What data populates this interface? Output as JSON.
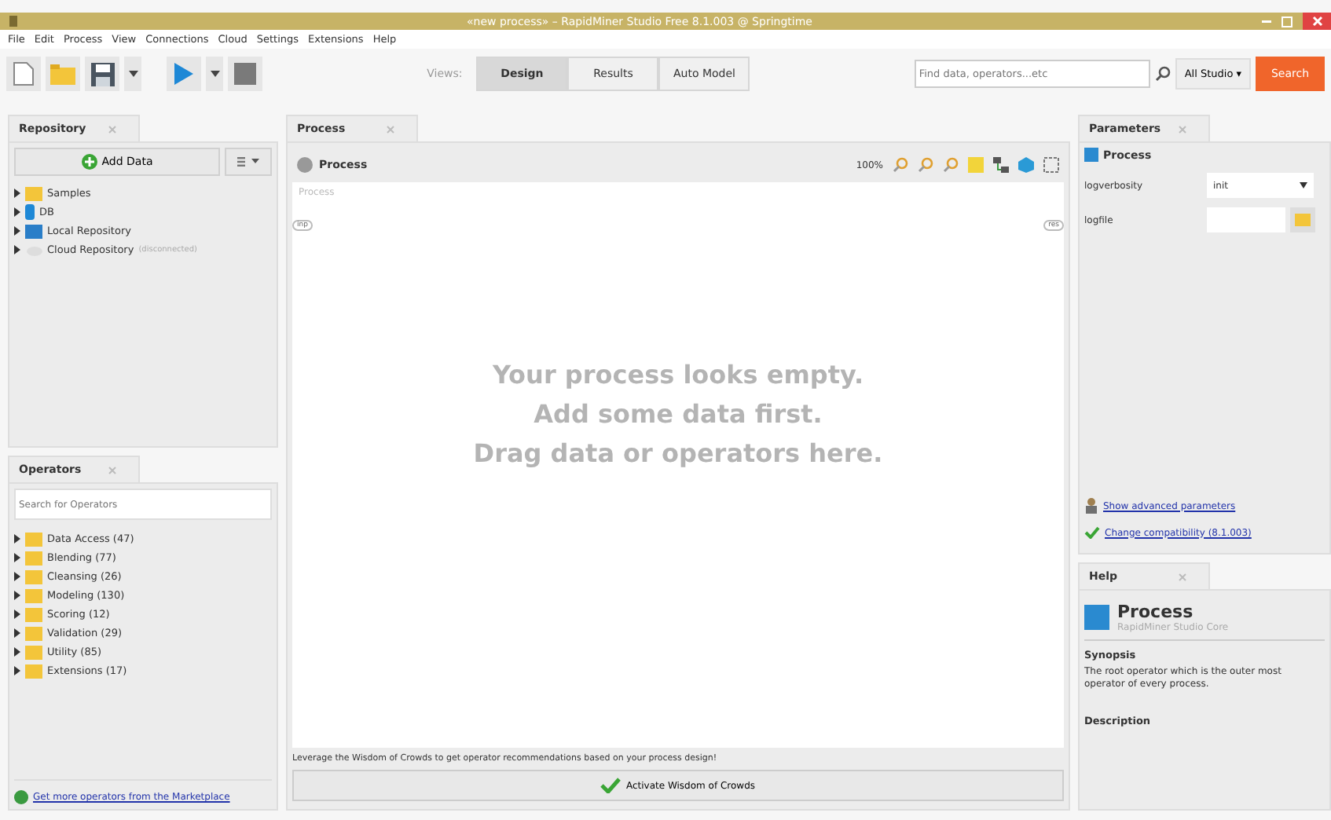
{
  "window": {
    "title": "«new process» – RapidMiner Studio Free 8.1.003 @ Springtime"
  },
  "menu": [
    "File",
    "Edit",
    "Process",
    "View",
    "Connections",
    "Cloud",
    "Settings",
    "Extensions",
    "Help"
  ],
  "toolbar": {
    "views_label": "Views:",
    "views": [
      {
        "label": "Design",
        "selected": true
      },
      {
        "label": "Results",
        "selected": false
      },
      {
        "label": "Auto Model",
        "selected": false
      }
    ],
    "search": {
      "placeholder": "Find data, operators...etc"
    },
    "scope": "All Studio ▾",
    "search_button": "Search"
  },
  "repository": {
    "tab": "Repository",
    "add_data": "Add Data",
    "items": [
      {
        "label": "Samples",
        "kind": "folder"
      },
      {
        "label": "DB",
        "kind": "db"
      },
      {
        "label": "Local Repository",
        "kind": "local"
      },
      {
        "label": "Cloud Repository",
        "note": "(disconnected)",
        "kind": "cloud"
      }
    ]
  },
  "operators": {
    "tab": "Operators",
    "search": {
      "placeholder": "Search for Operators"
    },
    "items": [
      "Data Access (47)",
      "Blending (77)",
      "Cleansing (26)",
      "Modeling (130)",
      "Scoring (12)",
      "Validation (29)",
      "Utility (85)",
      "Extensions (17)"
    ],
    "marketplace_link": "Get more operators from the Marketplace"
  },
  "process": {
    "tab": "Process",
    "breadcrumb": "Process",
    "zoom": "100%",
    "canvas_label": "Process",
    "port_in": "inp",
    "port_out": "res",
    "empty_lines": [
      "Your process looks empty.",
      "Add some data first.",
      "Drag data or operators here."
    ],
    "wisdom_text": "Leverage the Wisdom of Crowds to get operator recommendations based on your process design!",
    "wisdom_button": "Activate Wisdom of Crowds"
  },
  "parameters": {
    "tab": "Parameters",
    "operator": "Process",
    "rows": [
      {
        "label": "logverbosity",
        "kind": "select",
        "value": "init"
      },
      {
        "label": "logfile",
        "kind": "file",
        "value": ""
      }
    ],
    "advanced_link": "Show advanced parameters",
    "compat_link": "Change compatibility (8.1.003)"
  },
  "help": {
    "tab": "Help",
    "title": "Process",
    "subtitle": "RapidMiner Studio Core",
    "synopsis_heading": "Synopsis",
    "synopsis": "The root operator which is the outer most operator of every process.",
    "description_heading": "Description"
  }
}
